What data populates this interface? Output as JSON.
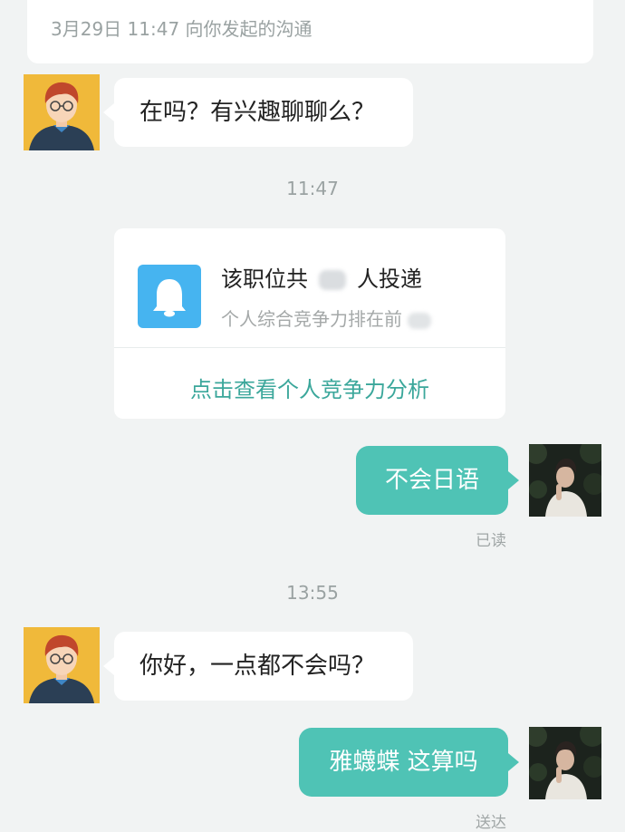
{
  "header": {
    "meta_text": "3月29日 11:47 向你发起的沟通"
  },
  "messages": [
    {
      "text": "在吗？有兴趣聊聊么？"
    },
    {
      "timestamp": "11:47"
    },
    {
      "card": {
        "title_prefix": "该职位共",
        "title_suffix": "人投递",
        "subtitle": "个人综合竞争力排在前",
        "link_label": "点击查看个人竞争力分析",
        "icon": "bell-icon",
        "icon_color": "#46b4f0"
      }
    },
    {
      "text": "不会日语",
      "status": "已读"
    },
    {
      "timestamp": "13:55"
    },
    {
      "text": "你好，一点都不会吗？"
    },
    {
      "text": "雅蠛蝶 这算吗",
      "status": "送达"
    }
  ],
  "colors": {
    "background": "#f1f3f3",
    "outgoing_bubble": "#4fc3b5",
    "incoming_bubble": "#ffffff",
    "link": "#3ba79b"
  }
}
